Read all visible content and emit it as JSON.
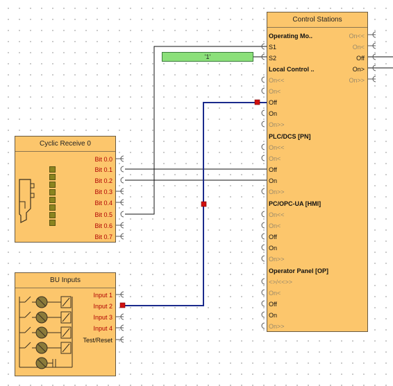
{
  "control_stations": {
    "title": "Control Stations",
    "operating_mode": {
      "header": "Operating Mo..",
      "s1": "S1",
      "s2": "S2"
    },
    "right_outputs": [
      "On<<",
      "On<",
      "Off",
      "On>",
      "On>>"
    ],
    "local_control": {
      "header": "Local Control ..",
      "items": [
        "On<<",
        "On<",
        "Off",
        "On",
        "On>>"
      ]
    },
    "plc_dcs": {
      "header": "PLC/DCS [PN]",
      "items": [
        "On<<",
        "On<",
        "Off",
        "On",
        "On>>"
      ]
    },
    "pc_opc": {
      "header": "PC/OPC-UA [HMI]",
      "items": [
        "On<<",
        "On<",
        "Off",
        "On",
        "On>>"
      ]
    },
    "operator_panel": {
      "header": "Operator Panel [OP]",
      "items": [
        "<>/<<>>",
        "On<",
        "Off",
        "On",
        "On>>"
      ]
    }
  },
  "constant_block": {
    "value": "'1'"
  },
  "cyclic_receive": {
    "title": "Cyclic Receive 0",
    "bits": [
      "Bit 0.0",
      "Bit 0.1",
      "Bit 0.2",
      "Bit 0.3",
      "Bit 0.4",
      "Bit 0.5",
      "Bit 0.6",
      "Bit 0.7"
    ]
  },
  "bu_inputs": {
    "title": "BU Inputs",
    "inputs": [
      "Input 1",
      "Input 2",
      "Input 3",
      "Input 4",
      "Test/Reset"
    ]
  },
  "colors": {
    "block_fill": "#fcc66c",
    "wire_blue": "#1a2a8c",
    "marker_red": "#d01010",
    "constant_green": "#8be07a"
  }
}
